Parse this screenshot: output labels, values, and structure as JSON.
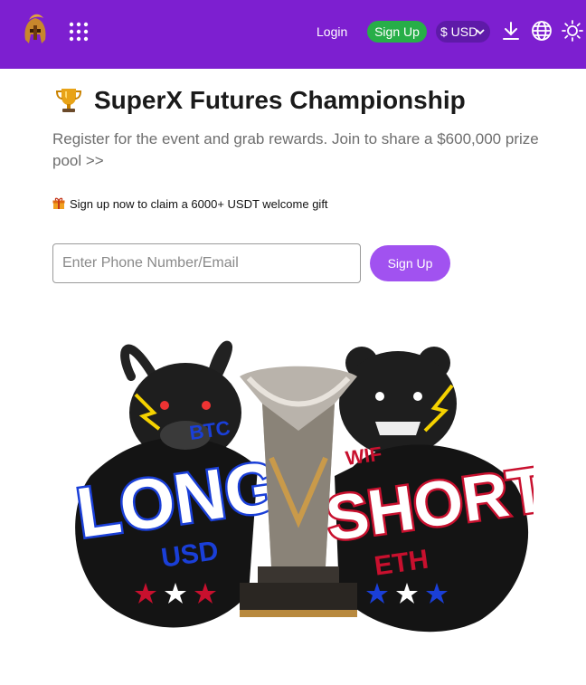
{
  "header": {
    "login_label": "Login",
    "signup_label": "Sign Up",
    "currency_label": "$ USD",
    "bar_color": "#7d1fd0",
    "signup_color": "#27ae48"
  },
  "hero": {
    "title": "SuperX Futures Championship",
    "subtitle": "Register for the event and grab rewards. Join to share a $600,000 prize pool >>",
    "gift_text": "Sign up now to claim a 6000+ USDT welcome gift"
  },
  "form": {
    "input_placeholder": "Enter Phone Number/Email",
    "input_value": "",
    "signup_label": "Sign Up",
    "button_color": "#a152f0"
  },
  "artwork": {
    "long_label": "LONG",
    "short_label": "SHORT",
    "btc_label": "BTC",
    "usd_label": "USD",
    "wif_label": "WIF",
    "eth_label": "ETH"
  },
  "icons": [
    "spartan-helmet-logo",
    "apps-grid-icon",
    "chevron-down-icon",
    "download-icon",
    "globe-icon",
    "sun-icon",
    "trophy-icon",
    "gift-icon"
  ]
}
